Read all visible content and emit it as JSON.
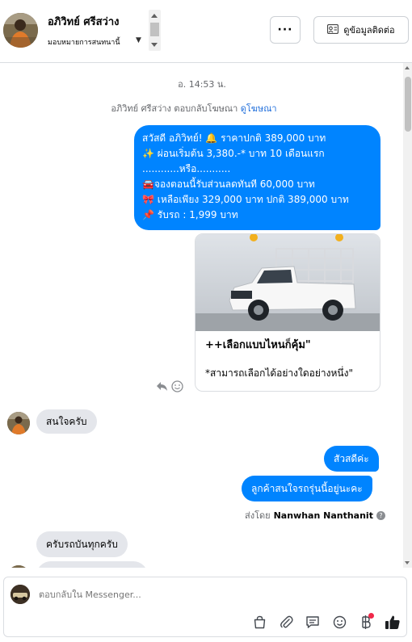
{
  "header": {
    "contact_name": "อภิวิทย์ ศรีสว่าง",
    "assign_label": "มอบหมายการสนทนานี้",
    "more_label": "···",
    "contact_info_label": "ดูข้อมูลติดต่อ"
  },
  "chat": {
    "timestamp": "อ. 14:53 น.",
    "reply_note": "อภิวิทย์ ศรีสว่าง ตอบกลับโฆษณา",
    "reply_note_link": "ดูโฆษณา",
    "promo_lines": [
      "สวัสดี อภิวิทย์! 🔔 ราคาปกติ 389,000 บาท",
      "✨  ผ่อนเริ่มต้น 3,380.-* บาท 10 เดือนแรก",
      "............หรือ...........",
      "🚘จองตอนนี้รับส่วนลดทันที 60,000 บาท",
      "🎀  เหลือเพียง 329,000 บาท ปกติ 389,000 บาท",
      "📌 รับรถ : 1,999 บาท"
    ],
    "card_title": "++เลือกแบบไหนก็คุ้ม\"",
    "card_subtitle": "*สามารถเลือกได้อย่างใดอย่างหนึ่ง\"",
    "msg_in_1": "สนใจครับ",
    "msg_out_1": "สัวสดีค่ะ",
    "msg_out_2": "ลูกค้าสนใจรถรุ่นนี้อยู่นะคะ",
    "sent_by_prefix": "ส่งโดย",
    "sent_by_name": "Nanwhan Nanthanit",
    "msg_in_2": "ครับรถบันทุกครับ"
  },
  "composer": {
    "placeholder": "ตอบกลับใน Messenger..."
  },
  "icons": {
    "toolbar": [
      "bag-icon",
      "attachment-icon",
      "saved-reply-icon",
      "emoji-icon",
      "baht-icon",
      "like-icon"
    ]
  },
  "colors": {
    "accent": "#0084ff",
    "incoming_bubble": "#e4e6eb",
    "link": "#216fdb"
  }
}
